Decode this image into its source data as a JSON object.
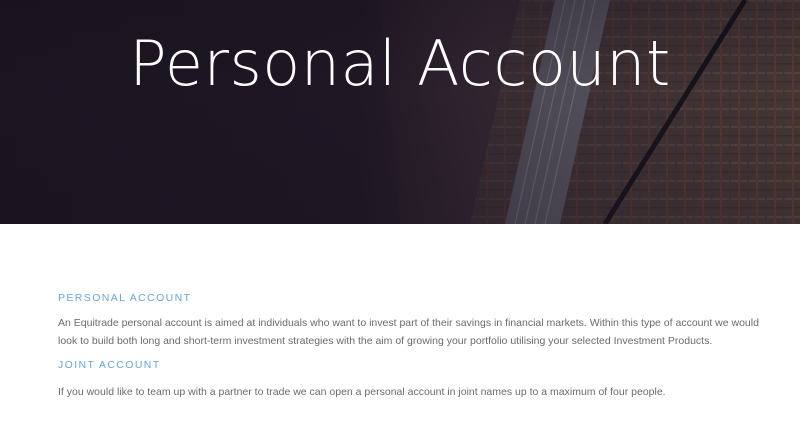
{
  "hero": {
    "title": "Personal Account"
  },
  "sections": [
    {
      "heading": "PERSONAL ACCOUNT",
      "text": "An Equitrade personal account is aimed at individuals who want to invest part of their savings in financial markets. Within this type of account we would look to build both long and short-term investment strategies with the aim of growing your portfolio utilising your selected Investment Products."
    },
    {
      "heading": "JOINT ACCOUNT",
      "text": "If you would like to team up with a partner to trade we can open a personal account in joint names up to a maximum of four people."
    }
  ],
  "colors": {
    "heading": "#6aa6d6",
    "body_text": "#6b6b6b",
    "hero_dark": "#1a1320",
    "hero_fabric": "#5a4538"
  }
}
